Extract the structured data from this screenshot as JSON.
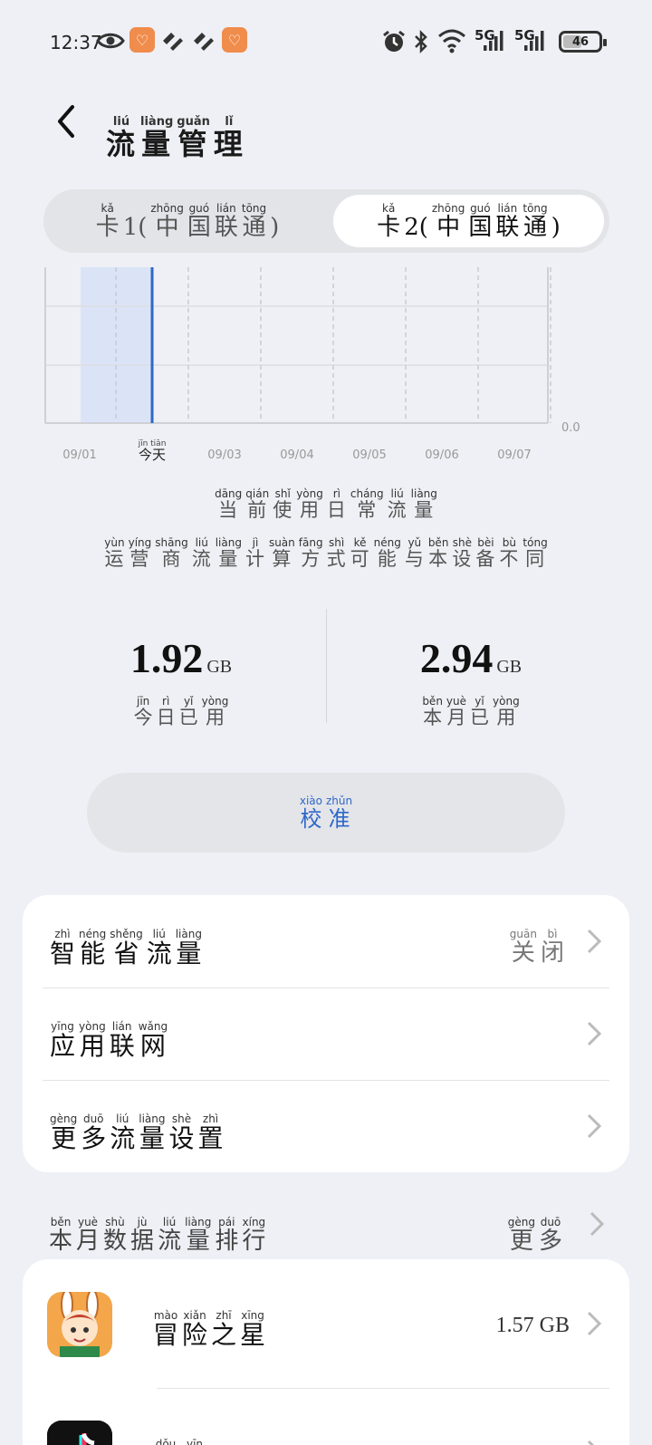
{
  "status_bar": {
    "time": "12:37",
    "network_1": "5G",
    "network_2": "5G",
    "battery": "46",
    "icons": [
      "eye-icon",
      "orange-app-icon",
      "swirl-icon",
      "alarm-icon",
      "bluetooth-icon",
      "wifi-icon",
      "signal-icon"
    ]
  },
  "header": {
    "title": [
      {
        "py": "liú",
        "zh": "流"
      },
      {
        "py": "liàng",
        "zh": "量"
      },
      {
        "py": "guǎn",
        "zh": "管"
      },
      {
        "py": "lǐ",
        "zh": "理"
      }
    ]
  },
  "sim_tabs": [
    {
      "tokens": [
        {
          "py": "kǎ",
          "zh": "卡"
        },
        {
          "py": "",
          "zh": " 1("
        },
        {
          "py": "zhōng",
          "zh": "中"
        },
        {
          "py": "guó",
          "zh": "国"
        },
        {
          "py": "lián",
          "zh": "联"
        },
        {
          "py": "tōng",
          "zh": "通"
        },
        {
          "py": "",
          "zh": ")"
        }
      ],
      "selected": false
    },
    {
      "tokens": [
        {
          "py": "kǎ",
          "zh": "卡"
        },
        {
          "py": "",
          "zh": " 2("
        },
        {
          "py": "zhōng",
          "zh": "中"
        },
        {
          "py": "guó",
          "zh": "国"
        },
        {
          "py": "lián",
          "zh": "联"
        },
        {
          "py": "tōng",
          "zh": "通"
        },
        {
          "py": "",
          "zh": ")"
        }
      ],
      "selected": true
    }
  ],
  "chart_data": {
    "type": "bar",
    "categories": [
      "09/01",
      "今天",
      "09/03",
      "09/04",
      "09/05",
      "09/06",
      "09/07"
    ],
    "today_label": {
      "py": "jīn tiān",
      "zh": "今天"
    },
    "values": [
      0,
      0,
      0,
      0,
      0,
      0,
      0
    ],
    "ytick_label": "0.0",
    "selected_category": "今天",
    "grid": true
  },
  "usage_note": [
    {
      "py": "dāng",
      "zh": "当"
    },
    {
      "py": "qián",
      "zh": "前"
    },
    {
      "py": "shǐ",
      "zh": "使"
    },
    {
      "py": "yòng",
      "zh": "用"
    },
    {
      "py": "rì",
      "zh": "日"
    },
    {
      "py": "cháng",
      "zh": "常"
    },
    {
      "py": "liú",
      "zh": "流"
    },
    {
      "py": "liàng",
      "zh": "量"
    }
  ],
  "carrier_note": [
    {
      "py": "yùn",
      "zh": "运"
    },
    {
      "py": "yíng",
      "zh": "营"
    },
    {
      "py": "shāng",
      "zh": "商"
    },
    {
      "py": "liú",
      "zh": "流"
    },
    {
      "py": "liàng",
      "zh": "量"
    },
    {
      "py": "jì",
      "zh": "计"
    },
    {
      "py": "suàn",
      "zh": "算"
    },
    {
      "py": "fāng",
      "zh": "方"
    },
    {
      "py": "shì",
      "zh": "式"
    },
    {
      "py": "kě",
      "zh": "可"
    },
    {
      "py": "néng",
      "zh": "能"
    },
    {
      "py": "yǔ",
      "zh": "与"
    },
    {
      "py": "běn",
      "zh": "本"
    },
    {
      "py": "shè",
      "zh": "设"
    },
    {
      "py": "bèi",
      "zh": "备"
    },
    {
      "py": "bù",
      "zh": "不"
    },
    {
      "py": "tóng",
      "zh": "同"
    }
  ],
  "today_usage": {
    "value": "1.92",
    "unit": "GB",
    "label": [
      {
        "py": "jīn",
        "zh": "今"
      },
      {
        "py": "rì",
        "zh": "日"
      },
      {
        "py": "yǐ",
        "zh": "已"
      },
      {
        "py": "yòng",
        "zh": "用"
      }
    ]
  },
  "month_usage": {
    "value": "2.94",
    "unit": "GB",
    "label": [
      {
        "py": "běn",
        "zh": "本"
      },
      {
        "py": "yuè",
        "zh": "月"
      },
      {
        "py": "yǐ",
        "zh": "已"
      },
      {
        "py": "yòng",
        "zh": "用"
      }
    ]
  },
  "calibrate_button": [
    {
      "py": "xiào",
      "zh": "校"
    },
    {
      "py": "zhǔn",
      "zh": "准"
    }
  ],
  "settings": [
    {
      "label": [
        {
          "py": "zhì",
          "zh": "智"
        },
        {
          "py": "néng",
          "zh": "能"
        },
        {
          "py": "shěng",
          "zh": "省"
        },
        {
          "py": "liú",
          "zh": "流"
        },
        {
          "py": "liàng",
          "zh": "量"
        }
      ],
      "value": [
        {
          "py": "guān",
          "zh": "关"
        },
        {
          "py": "bì",
          "zh": "闭"
        }
      ]
    },
    {
      "label": [
        {
          "py": "yīng",
          "zh": "应"
        },
        {
          "py": "yòng",
          "zh": "用"
        },
        {
          "py": "lián",
          "zh": "联"
        },
        {
          "py": "wǎng",
          "zh": "网"
        }
      ],
      "value": []
    },
    {
      "label": [
        {
          "py": "gèng",
          "zh": "更"
        },
        {
          "py": "duō",
          "zh": "多"
        },
        {
          "py": "liú",
          "zh": "流"
        },
        {
          "py": "liàng",
          "zh": "量"
        },
        {
          "py": "shè",
          "zh": "设"
        },
        {
          "py": "zhì",
          "zh": "置"
        }
      ],
      "value": []
    }
  ],
  "ranking": {
    "title": [
      {
        "py": "běn",
        "zh": "本"
      },
      {
        "py": "yuè",
        "zh": "月"
      },
      {
        "py": "shù",
        "zh": "数"
      },
      {
        "py": "jù",
        "zh": "据"
      },
      {
        "py": "liú",
        "zh": "流"
      },
      {
        "py": "liàng",
        "zh": "量"
      },
      {
        "py": "pái",
        "zh": "排"
      },
      {
        "py": "xíng",
        "zh": "行"
      }
    ],
    "more": [
      {
        "py": "gèng",
        "zh": "更"
      },
      {
        "py": "duō",
        "zh": "多"
      }
    ],
    "apps": [
      {
        "name": [
          {
            "py": "mào",
            "zh": "冒"
          },
          {
            "py": "xiǎn",
            "zh": "险"
          },
          {
            "py": "zhī",
            "zh": "之"
          },
          {
            "py": "xīng",
            "zh": "星"
          }
        ],
        "size": "1.57 GB",
        "icon": "adventure-star-app-icon"
      },
      {
        "name": [
          {
            "py": "dǒu",
            "zh": "抖"
          },
          {
            "py": "yīn",
            "zh": "音"
          }
        ],
        "size": "",
        "icon": "douyin-app-icon"
      }
    ]
  },
  "colors": {
    "accent": "#2f67c9",
    "background": "#eff0f5",
    "chart_highlight": "#dbe4f7"
  }
}
